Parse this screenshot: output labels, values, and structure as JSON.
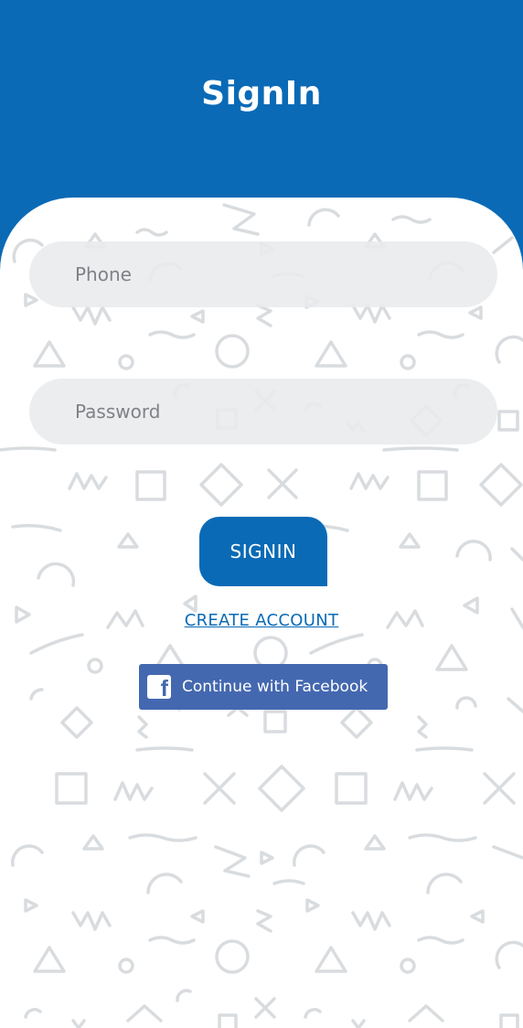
{
  "header": {
    "title": "SignIn",
    "background_color": "#0a6ab6"
  },
  "form": {
    "phone_placeholder": "Phone",
    "phone_value": "",
    "password_placeholder": "Password",
    "password_value": ""
  },
  "actions": {
    "signin_label": "SIGNIN",
    "create_account_label": "CREATE ACCOUNT",
    "facebook_label": "Continue with Facebook",
    "facebook_icon": "facebook-logo-icon",
    "facebook_color": "#4468b0"
  },
  "background": {
    "pattern": "memphis-shapes",
    "pattern_color": "#d9dcdf"
  }
}
